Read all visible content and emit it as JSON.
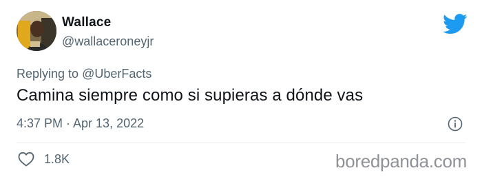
{
  "tweet": {
    "author_name": "Wallace",
    "author_handle": "@wallaceroneyjr",
    "replying_prefix": "Replying to",
    "replying_to": "@UberFacts",
    "text": "Camina siempre como si supieras a dónde vas",
    "timestamp": "4:37 PM · Apr 13, 2022",
    "like_count": "1.8K"
  },
  "icons": {
    "brand": "twitter-bird-icon",
    "info": "info-icon",
    "like": "heart-icon"
  },
  "watermark": "boredpanda.com",
  "colors": {
    "twitter_blue": "#1d9bf0",
    "secondary_text": "#536471",
    "primary_text": "#0f1419",
    "watermark": "#8f9296"
  }
}
